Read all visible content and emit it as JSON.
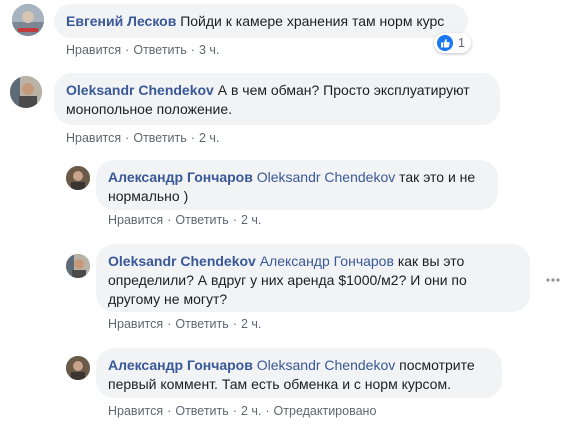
{
  "comments": [
    {
      "author": "Евгений Лесков",
      "text": "Пойди к камере хранения там норм курс",
      "actions": [
        "Нравится",
        "Ответить",
        "3 ч."
      ],
      "reactions": {
        "icon": "like-icon",
        "count": "1"
      }
    },
    {
      "author": "Oleksandr Chendekov",
      "text": "А в чем обман? Просто эксплуатируют монопольное положение.",
      "actions": [
        "Нравится",
        "Ответить",
        "2 ч."
      ]
    }
  ],
  "replies": [
    {
      "author": "Александр Гончаров",
      "mention": "Oleksandr Chendekov",
      "text": "так это и не нормально )",
      "actions": [
        "Нравится",
        "Ответить",
        "2 ч."
      ]
    },
    {
      "author": "Oleksandr Chendekov",
      "mention": "Александр Гончаров",
      "text": "как вы это определили? А вдруг у них аренда $1000/м2? И они по другому не могут?",
      "actions": [
        "Нравится",
        "Ответить",
        "2 ч."
      ]
    },
    {
      "author": "Александр Гончаров",
      "mention": "Oleksandr Chendekov",
      "text": "посмотрите первый коммент. Там есть обменка и с норм курсом.",
      "actions": [
        "Нравится",
        "Ответить",
        "2 ч.",
        "Отредактировано"
      ]
    }
  ],
  "colors": {
    "name": "#385898",
    "bubble": "#f2f3f5",
    "meta": "#606770",
    "like": "#1877f2"
  },
  "icons": [
    "like-icon",
    "more-options-icon"
  ]
}
